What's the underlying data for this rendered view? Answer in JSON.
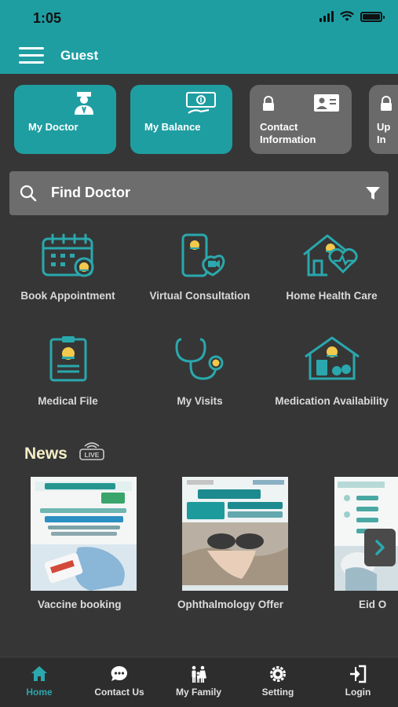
{
  "status": {
    "time": "1:05"
  },
  "header": {
    "title": "Guest"
  },
  "quick_cards": [
    {
      "label": "My Doctor",
      "icon": "doctor-icon"
    },
    {
      "label": "My Balance",
      "icon": "money-icon"
    },
    {
      "label": "Contact\nInformation",
      "icon": "id-card-icon"
    },
    {
      "label": "Up\nIn",
      "icon": "lock-icon"
    }
  ],
  "search": {
    "placeholder": "Find Doctor"
  },
  "services": [
    {
      "label": "Book Appointment",
      "icon": "calendar-icon"
    },
    {
      "label": "Virtual Consultation",
      "icon": "phone-video-icon"
    },
    {
      "label": "Home Health Care",
      "icon": "home-health-icon"
    },
    {
      "label": "Medical File",
      "icon": "clipboard-icon"
    },
    {
      "label": "My Visits",
      "icon": "stethoscope-icon"
    },
    {
      "label": "Medication Availability",
      "icon": "home-medication-icon"
    }
  ],
  "news": {
    "title": "News",
    "live_badge": "LIVE",
    "items": [
      {
        "label": "Vaccine booking"
      },
      {
        "label": "Ophthalmology Offer"
      },
      {
        "label": "Eid O"
      }
    ]
  },
  "bottom_nav": [
    {
      "label": "Home",
      "icon": "home-icon",
      "active": true
    },
    {
      "label": "Contact Us",
      "icon": "chat-icon",
      "active": false
    },
    {
      "label": "My Family",
      "icon": "family-icon",
      "active": false
    },
    {
      "label": "Setting",
      "icon": "gear-icon",
      "active": false
    },
    {
      "label": "Login",
      "icon": "login-icon",
      "active": false
    }
  ],
  "colors": {
    "teal": "#1f9ea2",
    "background": "#363636",
    "card_gray": "#6a6a6a",
    "icon_teal": "#2aa8ad",
    "news_title": "#f4eec6"
  }
}
